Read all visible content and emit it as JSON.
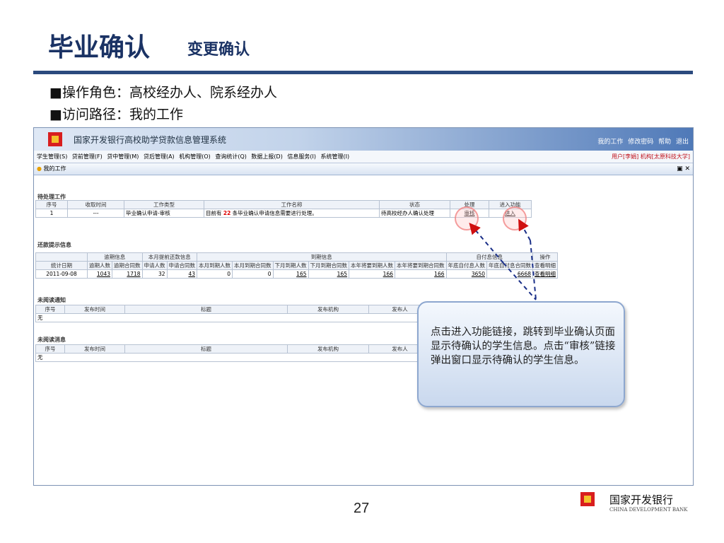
{
  "slide": {
    "title": "毕业确认",
    "subtitle": "变更确认",
    "bullet1": "■操作角色：高校经办人、院系经办人",
    "bullet2": "■访问路径：我的工作",
    "page_number": "27",
    "bank_name": "国家开发银行",
    "bank_name_en": "CHINA DEVELOPMENT BANK"
  },
  "app": {
    "system_title": "国家开发银行高校助学贷款信息管理系统",
    "top_links": [
      "我的工作",
      "修改密码",
      "帮助",
      "退出"
    ],
    "menu": [
      "学生管理(S)",
      "贷前管理(F)",
      "贷中管理(M)",
      "贷后管理(A)",
      "机构管理(O)",
      "查询统计(Q)",
      "数据上报(D)",
      "信息服务(I)",
      "系统管理(I)"
    ],
    "user_info": "用户[李娟] 机构[太原科技大学]",
    "tab_label": "我的工作"
  },
  "pending": {
    "section_title": "待处理工作",
    "headers": [
      "序号",
      "收取时间",
      "工作类型",
      "工作名称",
      "状态",
      "处理",
      "进入功能"
    ],
    "row": {
      "no": "1",
      "time": "---",
      "type": "毕业确认申请-审核",
      "name_prefix": "目前有",
      "name_count": "22",
      "name_suffix": "条毕业确认申请信息需要进行处理。",
      "status": "待高校经办人确认处理",
      "action": "审核",
      "enter": "进入"
    }
  },
  "repay": {
    "section_title": "还款提示信息",
    "groups": [
      "逾期信息",
      "本月提前还款信息",
      "到期信息",
      "自付息信息",
      "操作"
    ],
    "headers": [
      "统计日期",
      "逾期人数",
      "逾期合同数",
      "申请人数",
      "申请合同数",
      "本月到期人数",
      "本月到期合同数",
      "下月到期人数",
      "下月到期合同数",
      "本年将要到期人数",
      "本年将要到期合同数",
      "年底自付息人数",
      "年底自付息合同数",
      "查看明细"
    ],
    "row": [
      "2011-09-08",
      "1043",
      "1718",
      "32",
      "43",
      "0",
      "0",
      "165",
      "165",
      "166",
      "166",
      "3650",
      "6668",
      "查看明细"
    ]
  },
  "notice": {
    "section_title": "未阅读通知",
    "headers": [
      "序号",
      "发布时间",
      "标题",
      "发布机构",
      "发布人"
    ],
    "empty": "无"
  },
  "message": {
    "section_title": "未阅读消息",
    "headers": [
      "序号",
      "发布时间",
      "标题",
      "发布机构",
      "发布人"
    ],
    "empty": "无"
  },
  "callout": {
    "text": "点击进入功能链接，跳转到毕业确认页面显示待确认的学生信息。点击“审核”链接弹出窗口显示待确认的学生信息。"
  },
  "colors": {
    "title": "#1a3264",
    "rule": "#2b4a7e",
    "arrow": "#1a2f88",
    "highlight": "#e02020"
  }
}
